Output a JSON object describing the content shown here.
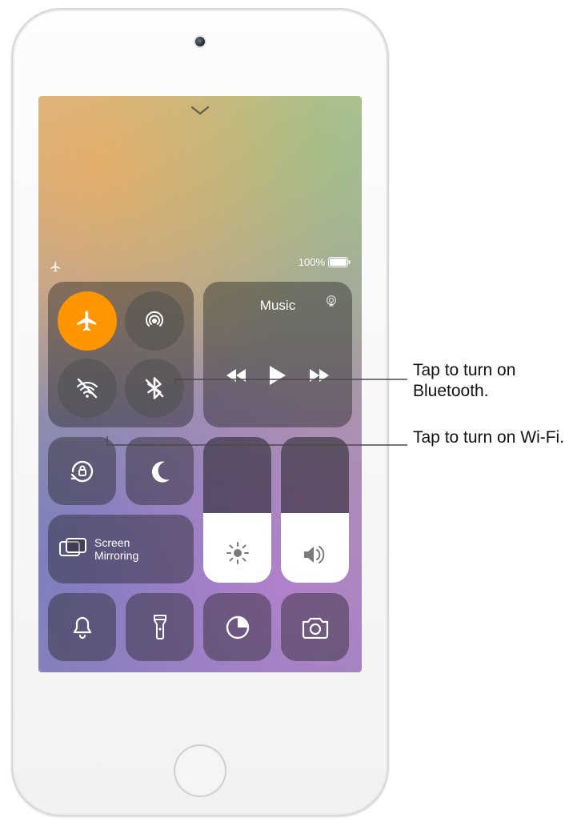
{
  "status": {
    "battery_percent_label": "100%"
  },
  "connectivity": {
    "airplane": {
      "name": "airplane-mode",
      "active": true
    },
    "airdrop": {
      "name": "airdrop",
      "active": false
    },
    "wifi": {
      "name": "wifi",
      "active": false
    },
    "bluetooth": {
      "name": "bluetooth",
      "active": false
    }
  },
  "music": {
    "title": "Music"
  },
  "screen_mirroring": {
    "label_line1": "Screen",
    "label_line2": "Mirroring"
  },
  "sliders": {
    "brightness_percent": 48,
    "volume_percent": 48
  },
  "callouts": {
    "bluetooth": "Tap to turn on Bluetooth.",
    "wifi": "Tap to turn on Wi-Fi."
  }
}
